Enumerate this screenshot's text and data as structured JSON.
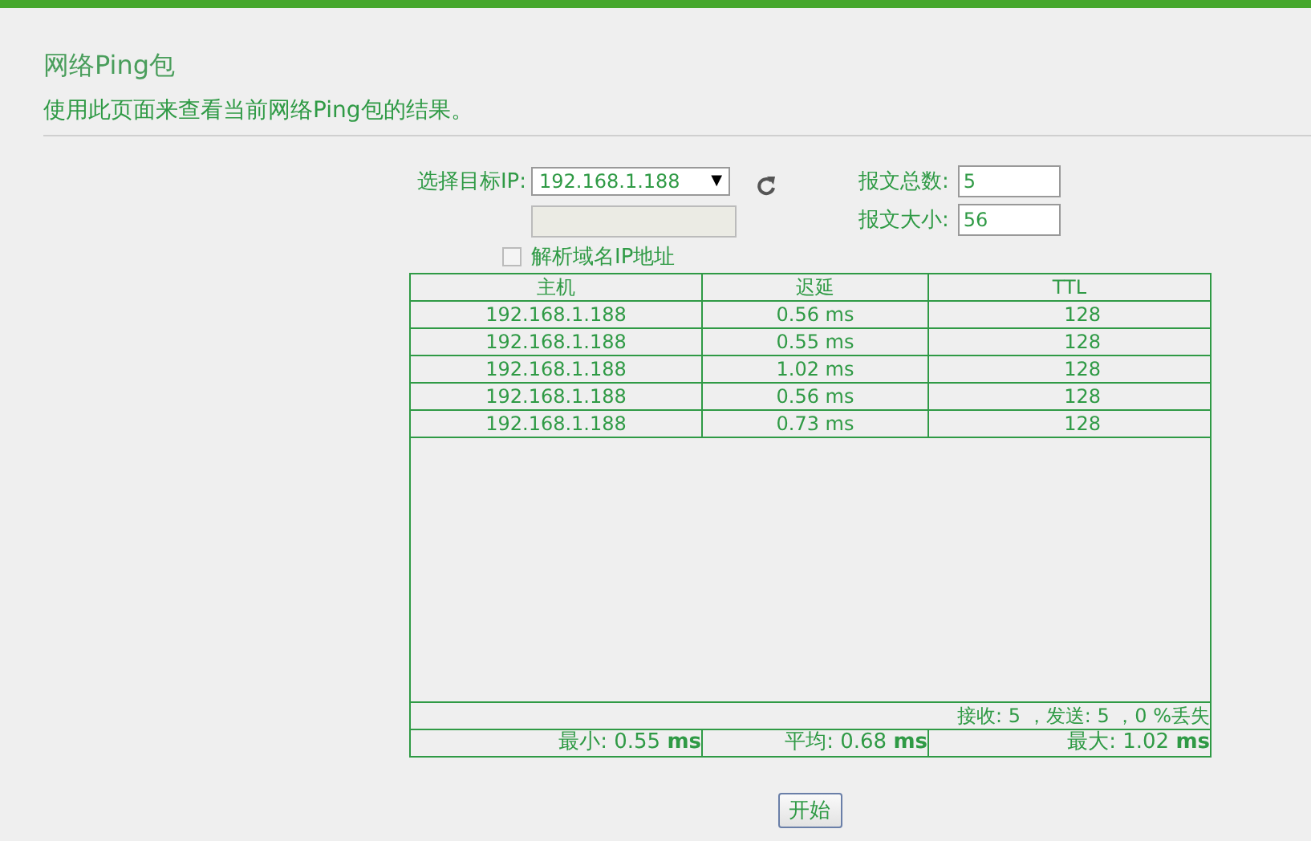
{
  "header": {
    "title": "网络Ping包",
    "description": "使用此页面来查看当前网络Ping包的结果。"
  },
  "form": {
    "target_label": "选择目标IP:",
    "target_value": "192.168.1.188",
    "target_arrow": "▼",
    "resolve_label": "解析域名IP地址",
    "resolve_checked": false,
    "count_label": "报文总数:",
    "count_value": "5",
    "size_label": "报文大小:",
    "size_value": "56"
  },
  "table": {
    "columns": [
      "主机",
      "迟延",
      "TTL"
    ],
    "rows": [
      {
        "host": "192.168.1.188",
        "delay": "0.56 ms",
        "ttl": "128"
      },
      {
        "host": "192.168.1.188",
        "delay": "0.55 ms",
        "ttl": "128"
      },
      {
        "host": "192.168.1.188",
        "delay": "1.02 ms",
        "ttl": "128"
      },
      {
        "host": "192.168.1.188",
        "delay": "0.56 ms",
        "ttl": "128"
      },
      {
        "host": "192.168.1.188",
        "delay": "0.73 ms",
        "ttl": "128"
      }
    ],
    "summary": "接收: 5 ，发送: 5 ，0 %丢失",
    "stats": [
      "最小: 0.55 **ms**",
      "平均: 0.68 **ms**",
      "最大: 1.02 **ms**"
    ]
  },
  "start_button": "开始"
}
